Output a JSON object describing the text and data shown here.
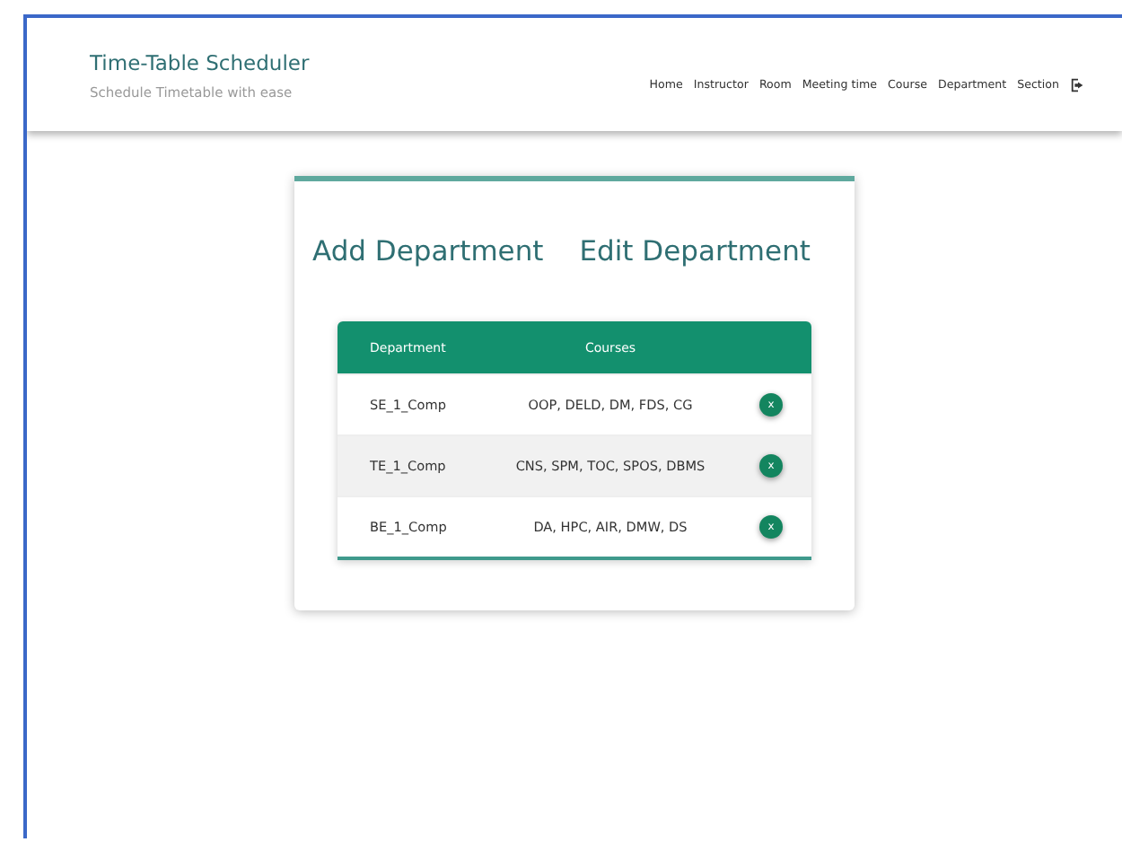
{
  "brand": {
    "title": "Time-Table Scheduler",
    "subtitle": "Schedule Timetable with ease"
  },
  "nav": [
    "Home",
    "Instructor",
    "Room",
    "Meeting time",
    "Course",
    "Department",
    "Section"
  ],
  "headings": [
    "Add Department",
    "Edit Department"
  ],
  "table": {
    "columns": [
      "Department",
      "Courses"
    ],
    "rows": [
      {
        "department": "SE_1_Comp",
        "courses": "OOP, DELD, DM, FDS, CG",
        "action": "x"
      },
      {
        "department": "TE_1_Comp",
        "courses": "CNS, SPM, TOC, SPOS, DBMS",
        "action": "x"
      },
      {
        "department": "BE_1_Comp",
        "courses": "DA, HPC, AIR, DMW, DS",
        "action": "x"
      }
    ]
  }
}
